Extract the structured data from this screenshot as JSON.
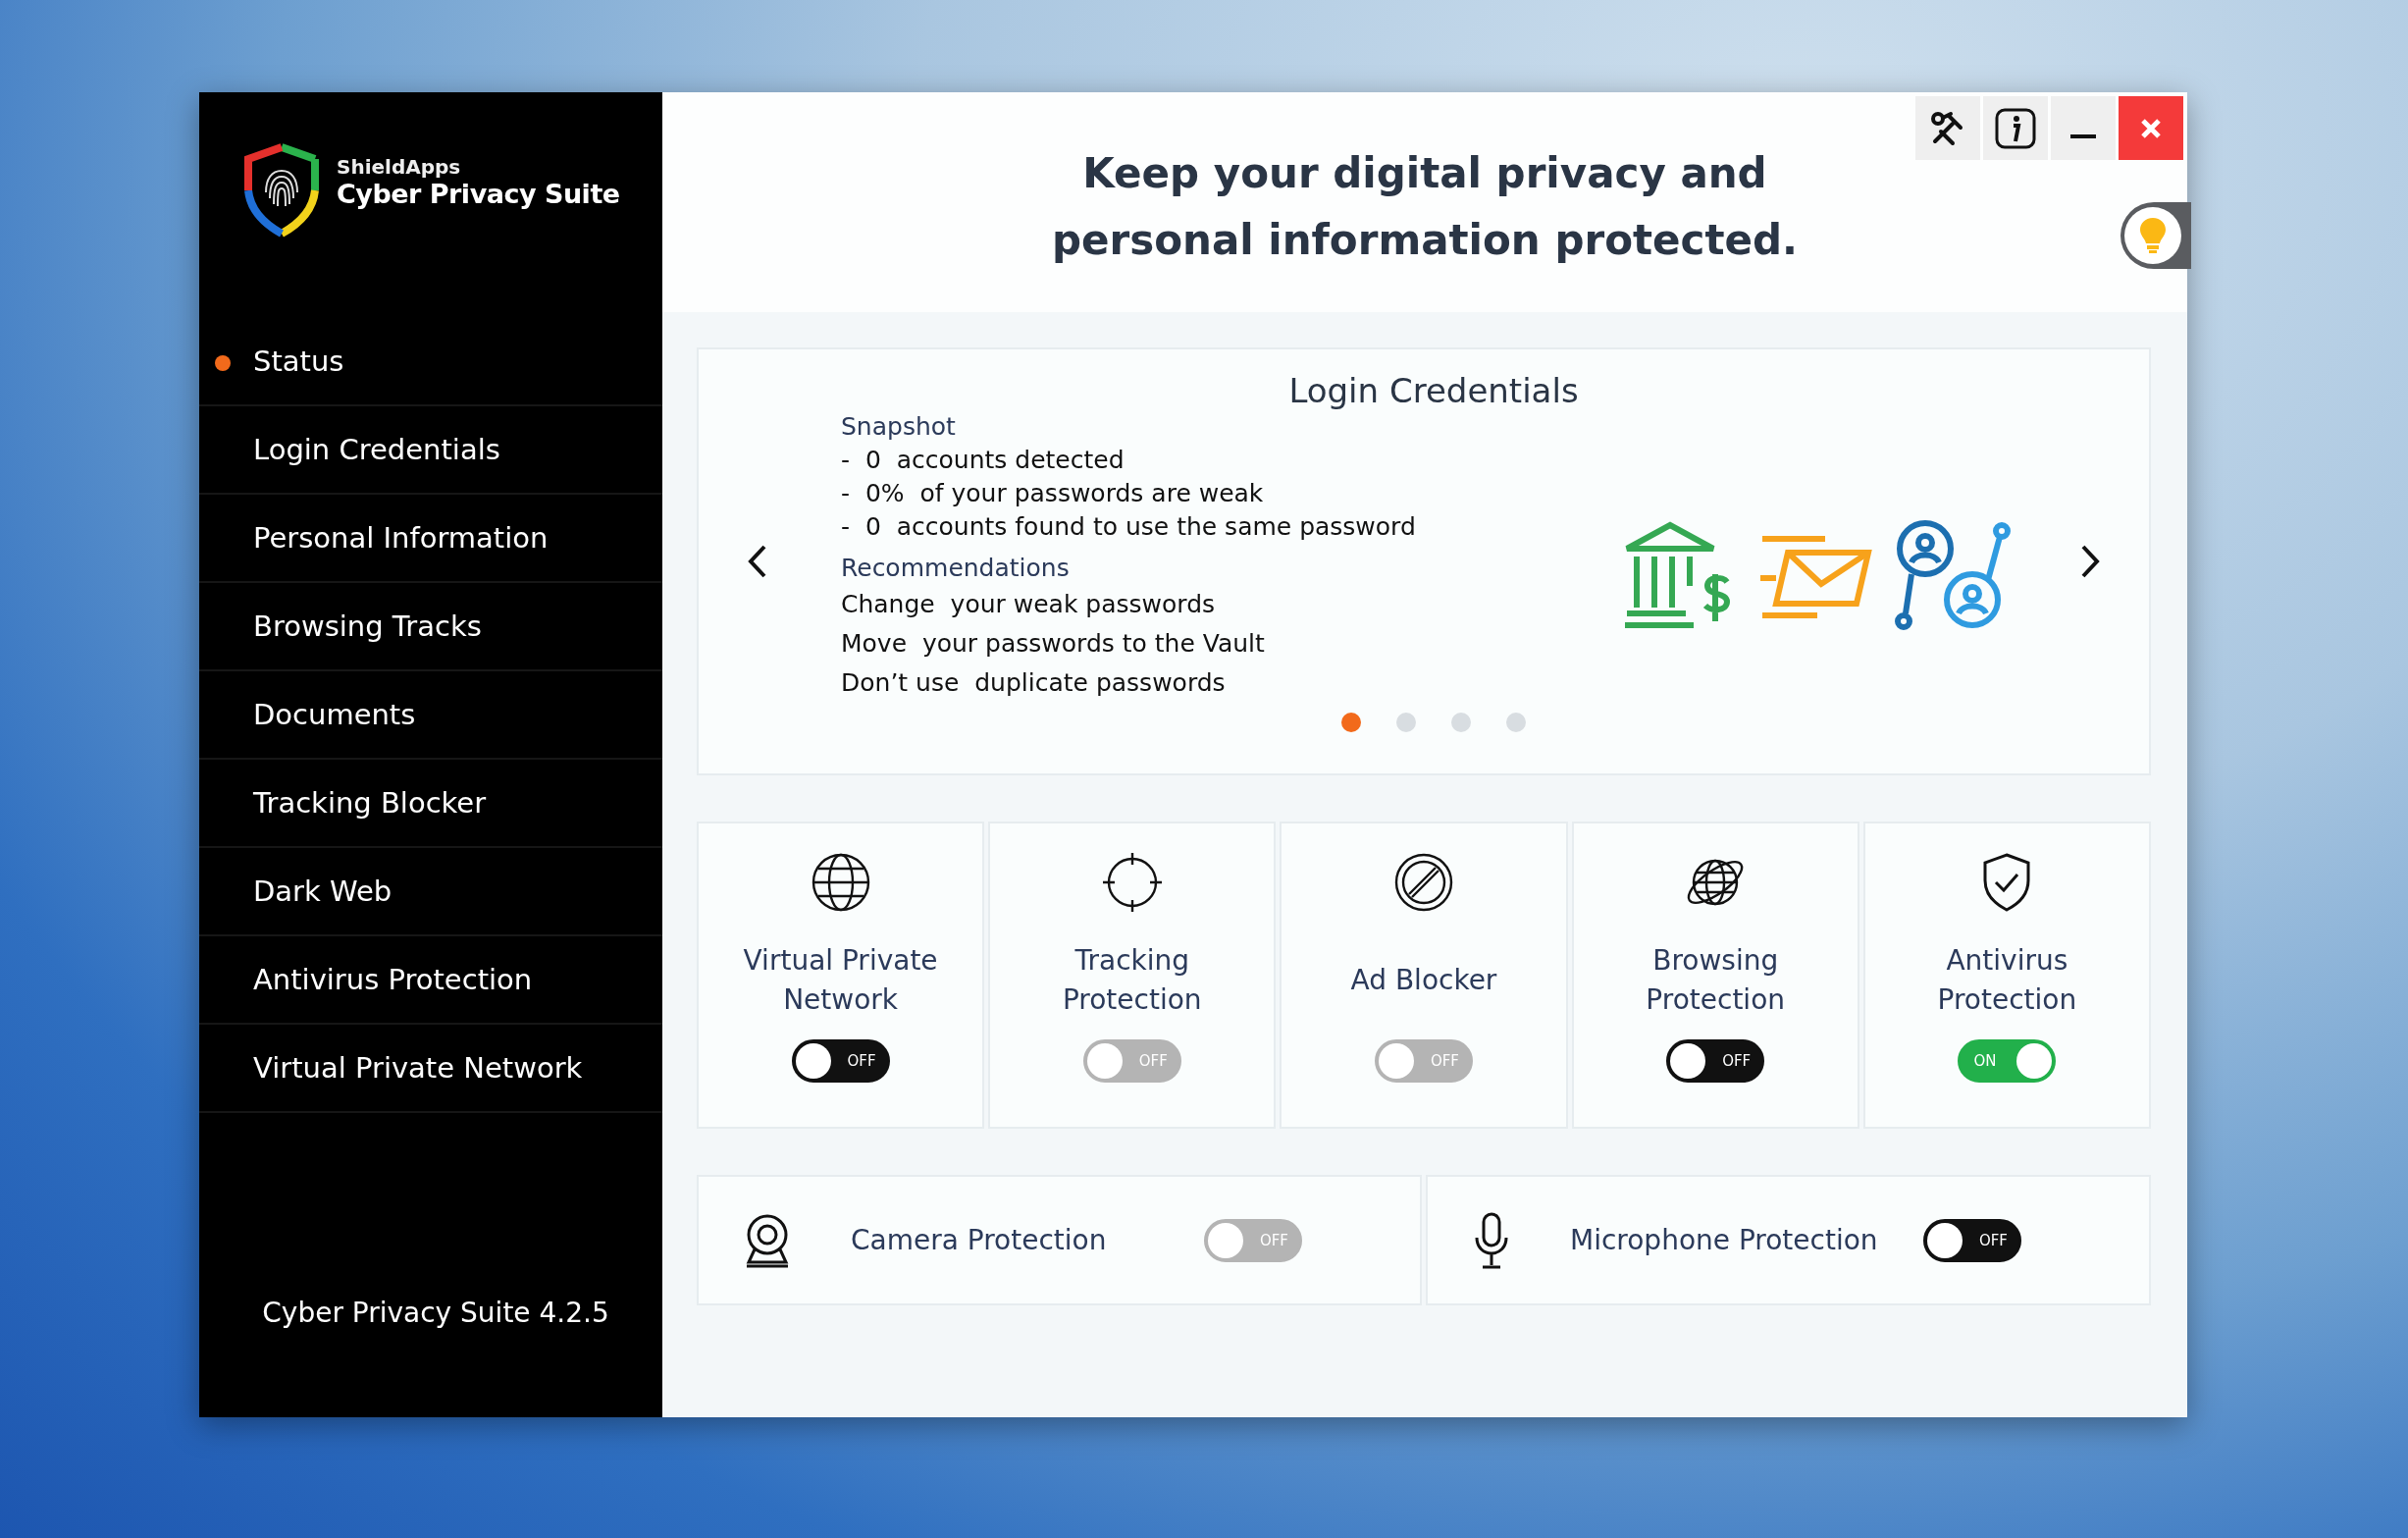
{
  "window": {
    "brand": "ShieldApps",
    "product": "Cyber Privacy Suite"
  },
  "sidebar": {
    "items": [
      {
        "label": "Status",
        "selected": true
      },
      {
        "label": "Login Credentials",
        "selected": false
      },
      {
        "label": "Personal Information",
        "selected": false
      },
      {
        "label": "Browsing Tracks",
        "selected": false
      },
      {
        "label": "Documents",
        "selected": false
      },
      {
        "label": "Tracking Blocker",
        "selected": false
      },
      {
        "label": "Dark Web",
        "selected": false
      },
      {
        "label": "Antivirus Protection",
        "selected": false
      },
      {
        "label": "Virtual Private Network",
        "selected": false
      }
    ],
    "version": "Cyber Privacy Suite 4.2.5"
  },
  "header": {
    "title_lines": [
      "Keep your digital privacy and",
      "personal information protected."
    ]
  },
  "carousel": {
    "title": "Login Credentials",
    "snapshot_heading": "Snapshot",
    "snapshot_items": [
      "-  0  accounts detected",
      "-  0%  of your passwords are weak",
      "-  0  accounts found to use the same password"
    ],
    "recommendations_heading": "Recommendations",
    "recommendations": [
      "Change  your weak passwords",
      "Move  your passwords to the Vault",
      "Don’t use  duplicate passwords"
    ],
    "pages": [
      {
        "selected": true
      },
      {
        "selected": false
      },
      {
        "selected": false
      },
      {
        "selected": false
      }
    ]
  },
  "features": [
    {
      "kind": "globe",
      "label": "Virtual Private Network",
      "on": false,
      "disabled": false,
      "switch_text": "OFF"
    },
    {
      "kind": "crosshair",
      "label": "Tracking Protection",
      "on": false,
      "disabled": true,
      "switch_text": "OFF"
    },
    {
      "kind": "ban",
      "label": "Ad Blocker",
      "on": false,
      "disabled": true,
      "switch_text": "OFF"
    },
    {
      "kind": "orbit",
      "label": "Browsing Protection",
      "on": false,
      "disabled": false,
      "switch_text": "OFF"
    },
    {
      "kind": "shield",
      "label": "Antivirus Protection",
      "on": true,
      "disabled": false,
      "switch_text": "ON"
    }
  ],
  "devices": [
    {
      "kind": "camera",
      "label": "Camera Protection",
      "on": false,
      "disabled": true,
      "switch_text": "OFF"
    },
    {
      "kind": "microphone",
      "label": "Microphone Protection",
      "on": false,
      "disabled": false,
      "switch_text": "OFF"
    }
  ]
}
